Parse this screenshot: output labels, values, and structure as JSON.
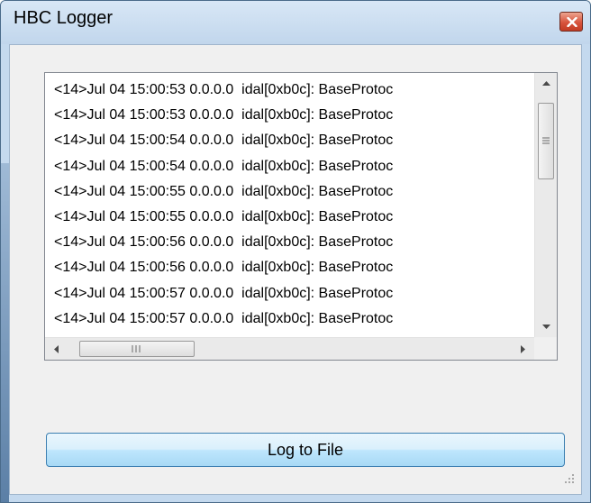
{
  "window": {
    "title": "HBC Logger",
    "close_icon": "close-icon"
  },
  "log": {
    "lines": [
      "<14>Jul 04 15:00:53 0.0.0.0  idal[0xb0c]: BaseProtoc",
      "<14>Jul 04 15:00:53 0.0.0.0  idal[0xb0c]: BaseProtoc",
      "<14>Jul 04 15:00:54 0.0.0.0  idal[0xb0c]: BaseProtoc",
      "<14>Jul 04 15:00:54 0.0.0.0  idal[0xb0c]: BaseProtoc",
      "<14>Jul 04 15:00:55 0.0.0.0  idal[0xb0c]: BaseProtoc",
      "<14>Jul 04 15:00:55 0.0.0.0  idal[0xb0c]: BaseProtoc",
      "<14>Jul 04 15:00:56 0.0.0.0  idal[0xb0c]: BaseProtoc",
      "<14>Jul 04 15:00:56 0.0.0.0  idal[0xb0c]: BaseProtoc",
      "<14>Jul 04 15:00:57 0.0.0.0  idal[0xb0c]: BaseProtoc",
      "<14>Jul 04 15:00:57 0.0.0.0  idal[0xb0c]: BaseProtoc"
    ]
  },
  "actions": {
    "log_to_file_label": "Log to File"
  },
  "colors": {
    "titlebar": "#c4d9ee",
    "button_border": "#3c7fb1",
    "close_button": "#d8533c"
  }
}
